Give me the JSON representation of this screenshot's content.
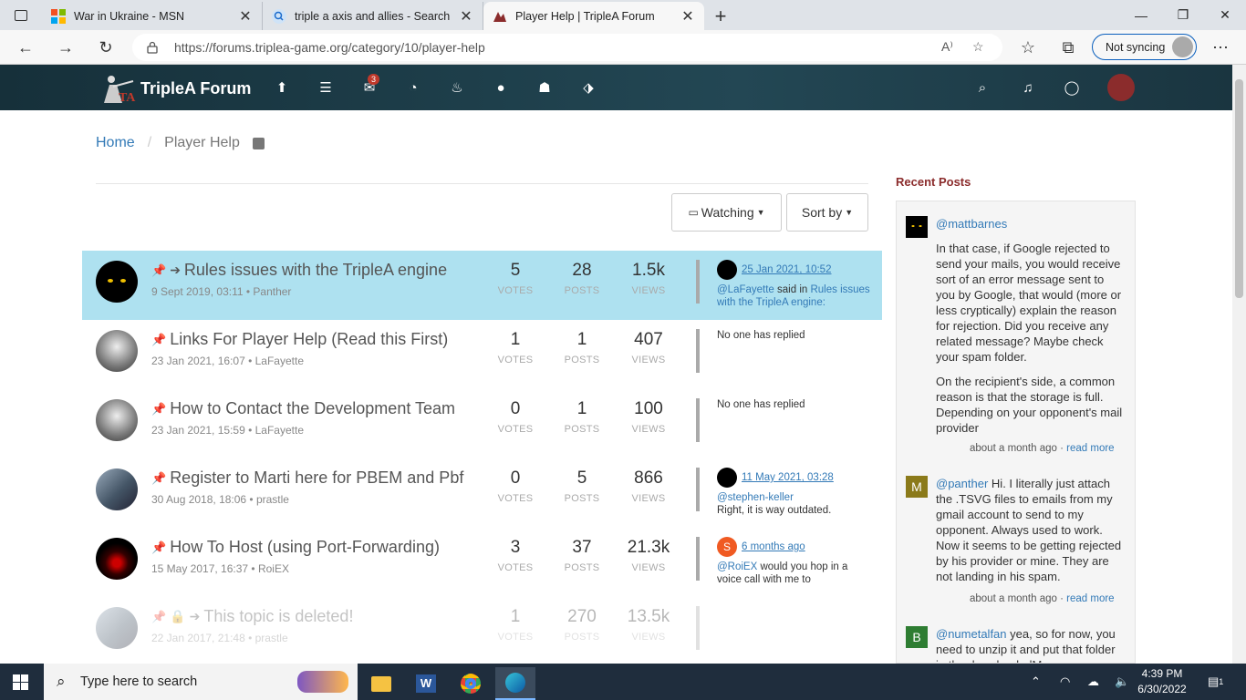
{
  "browser": {
    "tabs": [
      {
        "title": "War in Ukraine - MSN",
        "active": false
      },
      {
        "title": "triple a axis and allies - Search",
        "active": false
      },
      {
        "title": "Player Help | TripleA Forum",
        "active": true
      }
    ],
    "url": "https://forums.triplea-game.org/category/10/player-help",
    "sync_label": "Not syncing"
  },
  "forum": {
    "name": "TripleA Forum",
    "notification_count": "3",
    "breadcrumb": {
      "home": "Home",
      "current": "Player Help"
    },
    "watching_label": "Watching",
    "sort_label": "Sort by",
    "labels": {
      "votes": "VOTES",
      "posts": "POSTS",
      "views": "VIEWS"
    },
    "topics": [
      {
        "title": "Rules issues with the TripleA engine",
        "meta": "9 Sept 2019, 03:11 • Panther",
        "votes": "5",
        "posts": "28",
        "views": "1.5k",
        "last_time": "25 Jan 2021, 10:52",
        "last_user": "@LaFayette",
        "last_said": "said in",
        "last_link": "Rules issues with the TripleA engine:",
        "last_text": ""
      },
      {
        "title": "Links For Player Help (Read this First)",
        "meta": "23 Jan 2021, 16:07 • LaFayette",
        "votes": "1",
        "posts": "1",
        "views": "407",
        "no_reply": "No one has replied"
      },
      {
        "title": "How to Contact the Development Team",
        "meta": "23 Jan 2021, 15:59 • LaFayette",
        "votes": "0",
        "posts": "1",
        "views": "100",
        "no_reply": "No one has replied"
      },
      {
        "title": "Register to Marti here for PBEM and Pbf",
        "meta": "30 Aug 2018, 18:06 • prastle",
        "votes": "0",
        "posts": "5",
        "views": "866",
        "last_time": "11 May 2021, 03:28",
        "last_user": "@stephen-keller",
        "last_text": "Right, it is way outdated."
      },
      {
        "title": "How To Host (using Port-Forwarding)",
        "meta": "15 May 2017, 16:37 • RoiEX",
        "votes": "3",
        "posts": "37",
        "views": "21.3k",
        "last_time": "6 months ago",
        "last_user": "@RoiEX",
        "last_text": "would you hop in a voice call with me to",
        "last_avatar_letter": "S"
      },
      {
        "title": "This topic is deleted!",
        "meta": "22 Jan 2017, 21:48 • prastle",
        "votes": "1",
        "posts": "270",
        "views": "13.5k"
      }
    ],
    "recent": {
      "heading": "Recent Posts",
      "posts": [
        {
          "user": "@mattbarnes",
          "text1": "In that case, if Google rejected to send your mails, you would receive sort of an error message sent to you by Google, that would (more or less cryptically) explain the reason for rejection. Did you receive any related message? Maybe check your spam folder.",
          "text2": "On the recipient's side, a common reason is that the storage is full. Depending on your opponent's mail provider",
          "time": "about a month ago",
          "more": "read more"
        },
        {
          "user": "@panther",
          "avatar_letter": "M",
          "text1": "Hi. I literally just attach the .TSVG files to emails from my gmail account to send to my opponent. Always used to work. Now it seems to be getting rejected by his provider or mine. They are not landing in his spam.",
          "time": "about a month ago",
          "more": "read more"
        },
        {
          "user": "@numetalfan",
          "avatar_letter": "B",
          "text1": "yea, so for now, you need to unzip it and put that folder in the downloadedMaps"
        }
      ]
    }
  },
  "taskbar": {
    "search_placeholder": "Type here to search",
    "time": "4:39 PM",
    "date": "6/30/2022",
    "notif_count": "1"
  },
  "colors": {
    "header": "#1e3f4b",
    "highlight": "#aee1f0",
    "link": "#337ab7",
    "pin": "#c0392b",
    "recent_heading": "#8b2c2c"
  }
}
